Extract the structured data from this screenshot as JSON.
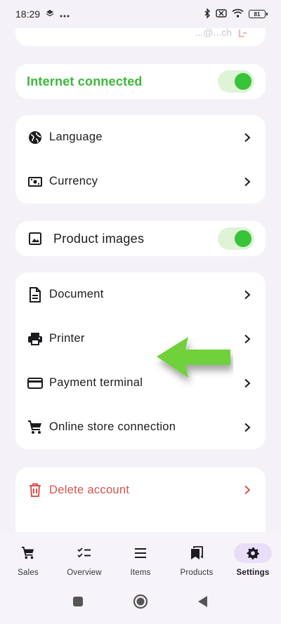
{
  "status": {
    "time": "18:29",
    "battery": "81"
  },
  "top_card": {
    "text": "...@...ch"
  },
  "internet": {
    "label": "Internet connected",
    "enabled": true
  },
  "general": [
    {
      "label": "Language",
      "icon": "globe-icon"
    },
    {
      "label": "Currency",
      "icon": "banknote-icon"
    }
  ],
  "product_images": {
    "label": "Product images",
    "enabled": true
  },
  "devices": [
    {
      "label": "Document",
      "icon": "document-icon"
    },
    {
      "label": "Printer",
      "icon": "printer-icon"
    },
    {
      "label": "Payment terminal",
      "icon": "credit-card-icon"
    },
    {
      "label": "Online store connection",
      "icon": "cart-icon"
    }
  ],
  "delete_account": {
    "label": "Delete account",
    "color": "#d9534f"
  },
  "nav": [
    {
      "label": "Sales",
      "icon": "cart-icon",
      "active": false
    },
    {
      "label": "Overview",
      "icon": "checklist-icon",
      "active": false
    },
    {
      "label": "Items",
      "icon": "list-icon",
      "active": false
    },
    {
      "label": "Products",
      "icon": "bookmarks-icon",
      "active": false
    },
    {
      "label": "Settings",
      "icon": "gear-icon",
      "active": true
    }
  ],
  "colors": {
    "accent_green": "#35c43a",
    "toggle_track": "#dff3d6",
    "active_nav_bg": "#e8def8",
    "annotation_arrow": "#6fd13a"
  }
}
